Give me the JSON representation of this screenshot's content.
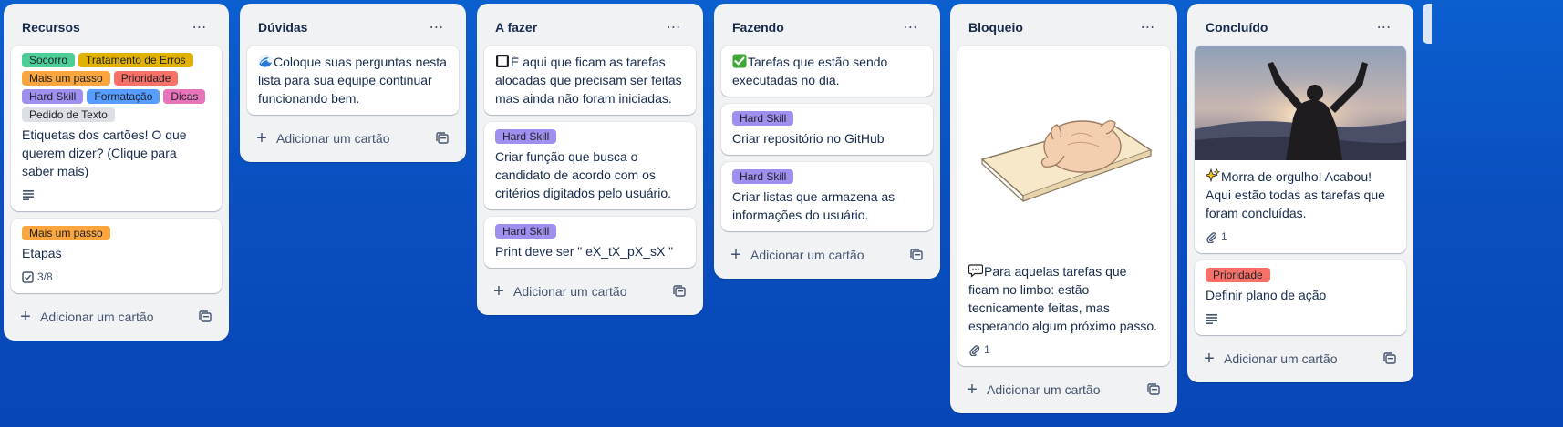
{
  "colors": {
    "green": "#4bce97",
    "yellow": "#e2b203",
    "orange": "#faa53d",
    "red": "#f87168",
    "purple": "#9f8fef",
    "blue": "#579dff",
    "pink": "#e774bb",
    "gray": "#dcdfe4"
  },
  "add_card_label": "Adicionar um cartão",
  "lists": [
    {
      "title": "Recursos",
      "cards": [
        {
          "labels": [
            "Socorro",
            "Tratamento de Erros",
            "Mais um passo",
            "Prioridade",
            "Hard Skill",
            "Formatação",
            "Dicas",
            "Pedido de Texto"
          ],
          "text": "Etiquetas dos cartões! O que querem dizer? (Clique para saber mais)",
          "badge_description": "description-icon"
        },
        {
          "labels": [
            "Mais um passo"
          ],
          "text": "Etapas",
          "checklist": "3/8"
        }
      ]
    },
    {
      "title": "Dúvidas",
      "cards": [
        {
          "text": "Coloque suas perguntas nesta lista para sua equipe continuar funcionando bem.",
          "emoji": "wave-emoji"
        }
      ]
    },
    {
      "title": "A fazer",
      "cards": [
        {
          "text": "É aqui que ficam as tarefas alocadas que precisam ser feitas mas ainda não foram iniciadas.",
          "emoji": "black-square-emoji"
        },
        {
          "labels": [
            "Hard Skill"
          ],
          "text": "Criar função que busca o candidato de acordo com os critérios digitados pelo usuário."
        },
        {
          "labels": [
            "Hard Skill"
          ],
          "text": "Print deve ser \" eX_tX_pX_sX \""
        }
      ]
    },
    {
      "title": "Fazendo",
      "cards": [
        {
          "text": "Tarefas que estão sendo executadas no dia.",
          "emoji": "check-mark-emoji"
        },
        {
          "labels": [
            "Hard Skill"
          ],
          "text": "Criar repositório no GitHub"
        },
        {
          "labels": [
            "Hard Skill"
          ],
          "text": "Criar listas que armazena as informações do usuário."
        }
      ]
    },
    {
      "title": "Bloqueio",
      "cards": [
        {
          "text": "Para aquelas tarefas que ficam no limbo: estão tecnicamente feitas, mas esperando algum próximo passo.",
          "emoji": "speech-bubble-emoji",
          "attachments": "1",
          "image": "cat-on-board-illustration"
        }
      ]
    },
    {
      "title": "Concluído",
      "cards": [
        {
          "text": "Morra de orgulho! Acabou! Aqui estão todas as tarefas que foram concluídas.",
          "emoji": "sparkles-emoji",
          "attachments": "1",
          "image": "celebration-photo"
        },
        {
          "labels": [
            "Prioridade"
          ],
          "text": "Definir plano de ação",
          "badge_description": "description-icon"
        }
      ]
    }
  ]
}
